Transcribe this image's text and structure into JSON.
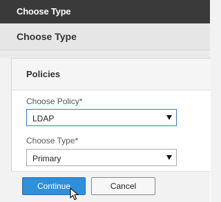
{
  "window": {
    "title": "Choose Type"
  },
  "header": {
    "title": "Choose Type"
  },
  "panel": {
    "title": "Policies",
    "fields": [
      {
        "label": "Choose Policy*",
        "value": "LDAP"
      },
      {
        "label": "Choose Type*",
        "value": "Primary"
      }
    ]
  },
  "buttons": {
    "continue_label": "Continue",
    "cancel_label": "Cancel"
  },
  "colors": {
    "titlebar": "#3a3a3a",
    "primary_button": "#2f8fd8",
    "focus_border": "#3b78c2"
  },
  "icons": {
    "pointer": "mouse-pointer-icon",
    "dropdown": "chevron-down-icon"
  }
}
